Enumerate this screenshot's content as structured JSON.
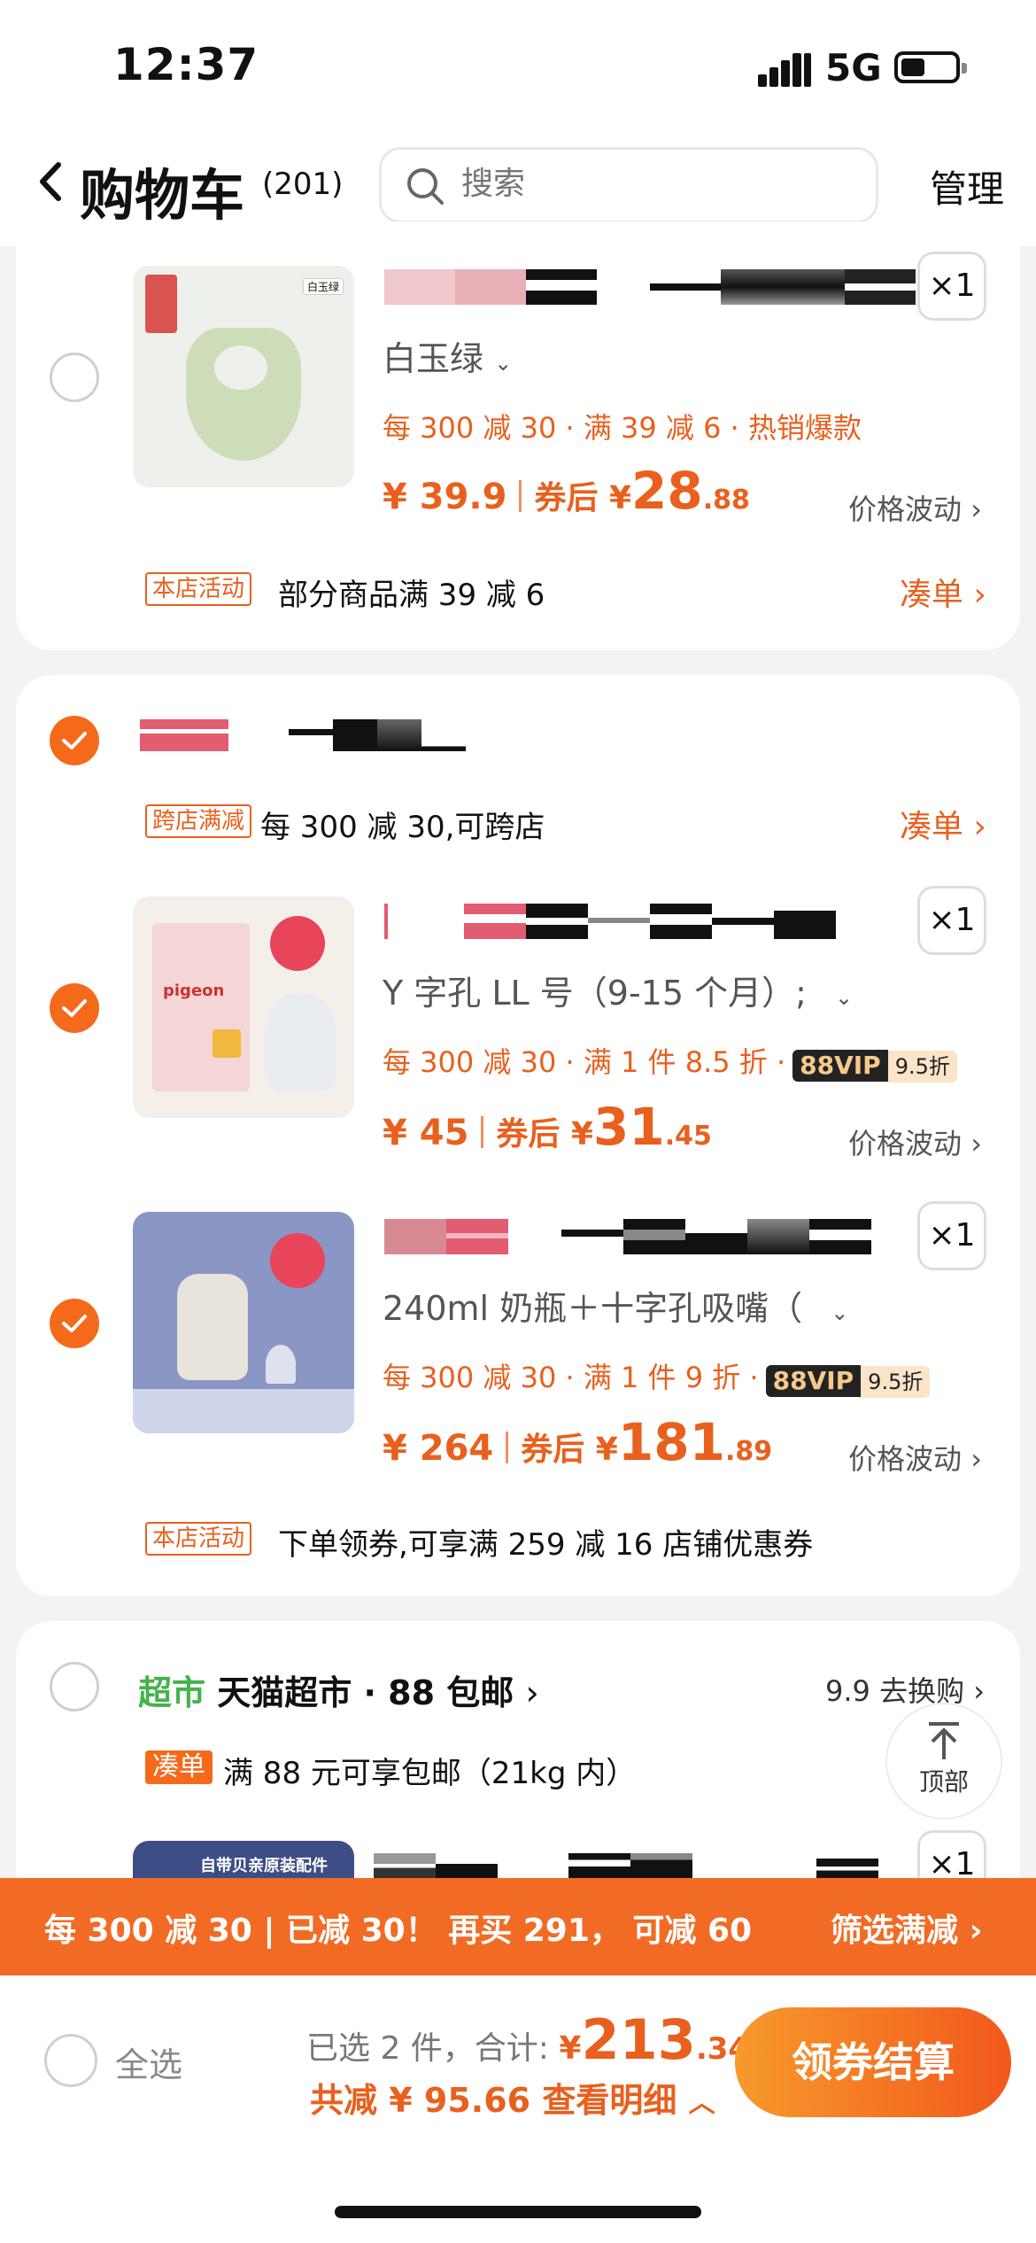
{
  "status": {
    "time": "12:37",
    "network": "5G"
  },
  "header": {
    "title": "购物车",
    "count": "(201)",
    "search_placeholder": "搜索",
    "manage": "管理"
  },
  "item1": {
    "qty": "×1",
    "sku": "白玉绿",
    "promo": "每 300 减 30 · 满 39 减 6 · 热销爆款",
    "price": "¥ 39.9",
    "coupon_label": "券后 ¥",
    "coupon_int": "28",
    "coupon_dec": ".88",
    "trend": "价格波动",
    "thumb_tag": "白玉绿"
  },
  "store1_activity": {
    "tag": "本店活动",
    "text": "部分商品满 39 减 6",
    "action": "凑单"
  },
  "store2": {
    "cross_tag": "跨店满减",
    "cross_text": "每 300 减 30,可跨店",
    "cross_action": "凑单",
    "items": [
      {
        "qty": "×1",
        "sku": "Y 字孔 LL 号（9-15 个月）;",
        "promo": "每 300 减 30 · 满 1 件 8.5 折 ·",
        "vip": "88VIP",
        "vip_discount": "9.5折",
        "price": "¥ 45",
        "coupon_label": "券后 ¥",
        "coupon_int": "31",
        "coupon_dec": ".45",
        "trend": "价格波动"
      },
      {
        "qty": "×1",
        "sku": "240ml 奶瓶＋十字孔吸嘴（",
        "promo": "每 300 减 30 · 满 1 件 9 折 ·",
        "vip": "88VIP",
        "vip_discount": "9.5折",
        "price": "¥ 264",
        "coupon_label": "券后 ¥",
        "coupon_int": "181",
        "coupon_dec": ".89",
        "trend": "价格波动"
      }
    ],
    "activity_tag": "本店活动",
    "activity_text": "下单领券,可享满 259 减 16 店铺优惠券"
  },
  "store3": {
    "badge": "超市",
    "name": "天猫超市 · 88 包邮",
    "exchange": "9.9 去换购",
    "tag": "凑单",
    "text": "满 88 元可享包邮（21kg 内）",
    "qty": "×1",
    "thumb_text": "自带贝亲原装配件"
  },
  "float_top": {
    "label": "顶部"
  },
  "promo_bar": {
    "left": "每 300 减 30 | 已减 30！ 再买 291， 可减 60",
    "right": "筛选满减"
  },
  "bottom": {
    "select_all": "全选",
    "selected": "已选 2 件，合计:",
    "currency": "¥",
    "total_int": "213",
    "total_dec": ".34",
    "saved": "共减 ¥ 95.66 查看明细",
    "checkout": "领券结算"
  },
  "colors": {
    "accent": "#f46a1a",
    "price": "#e9601e",
    "super_green": "#44b34a"
  }
}
